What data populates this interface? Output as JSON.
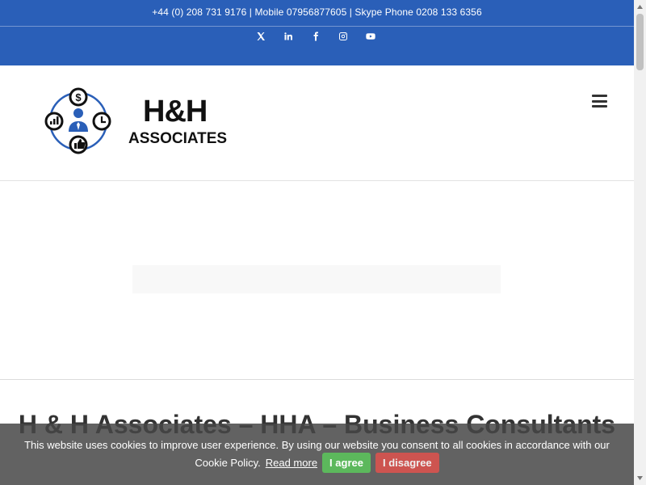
{
  "topbar": {
    "contact_line": "+44 (0) 208 731 9176 | Mobile 07956877605 | Skype Phone 0208 133 6356",
    "social_icons": [
      "x-icon",
      "linkedin-icon",
      "facebook-icon",
      "instagram-icon",
      "youtube-icon"
    ],
    "background_color": "#2a5fb8"
  },
  "header": {
    "logo_title": "H&H",
    "logo_subtitle": "ASSOCIATES",
    "menu_icon": "hamburger-menu-icon"
  },
  "main": {
    "page_title": "H & H Associates – HHA – Business Consultants"
  },
  "cookie_bar": {
    "message": "This website uses cookies to improve user experience. By using our website you consent to all cookies in accordance with our",
    "policy_label": "Cookie Policy.",
    "read_more_label": "Read more",
    "agree_label": "I agree",
    "disagree_label": "I disagree"
  }
}
